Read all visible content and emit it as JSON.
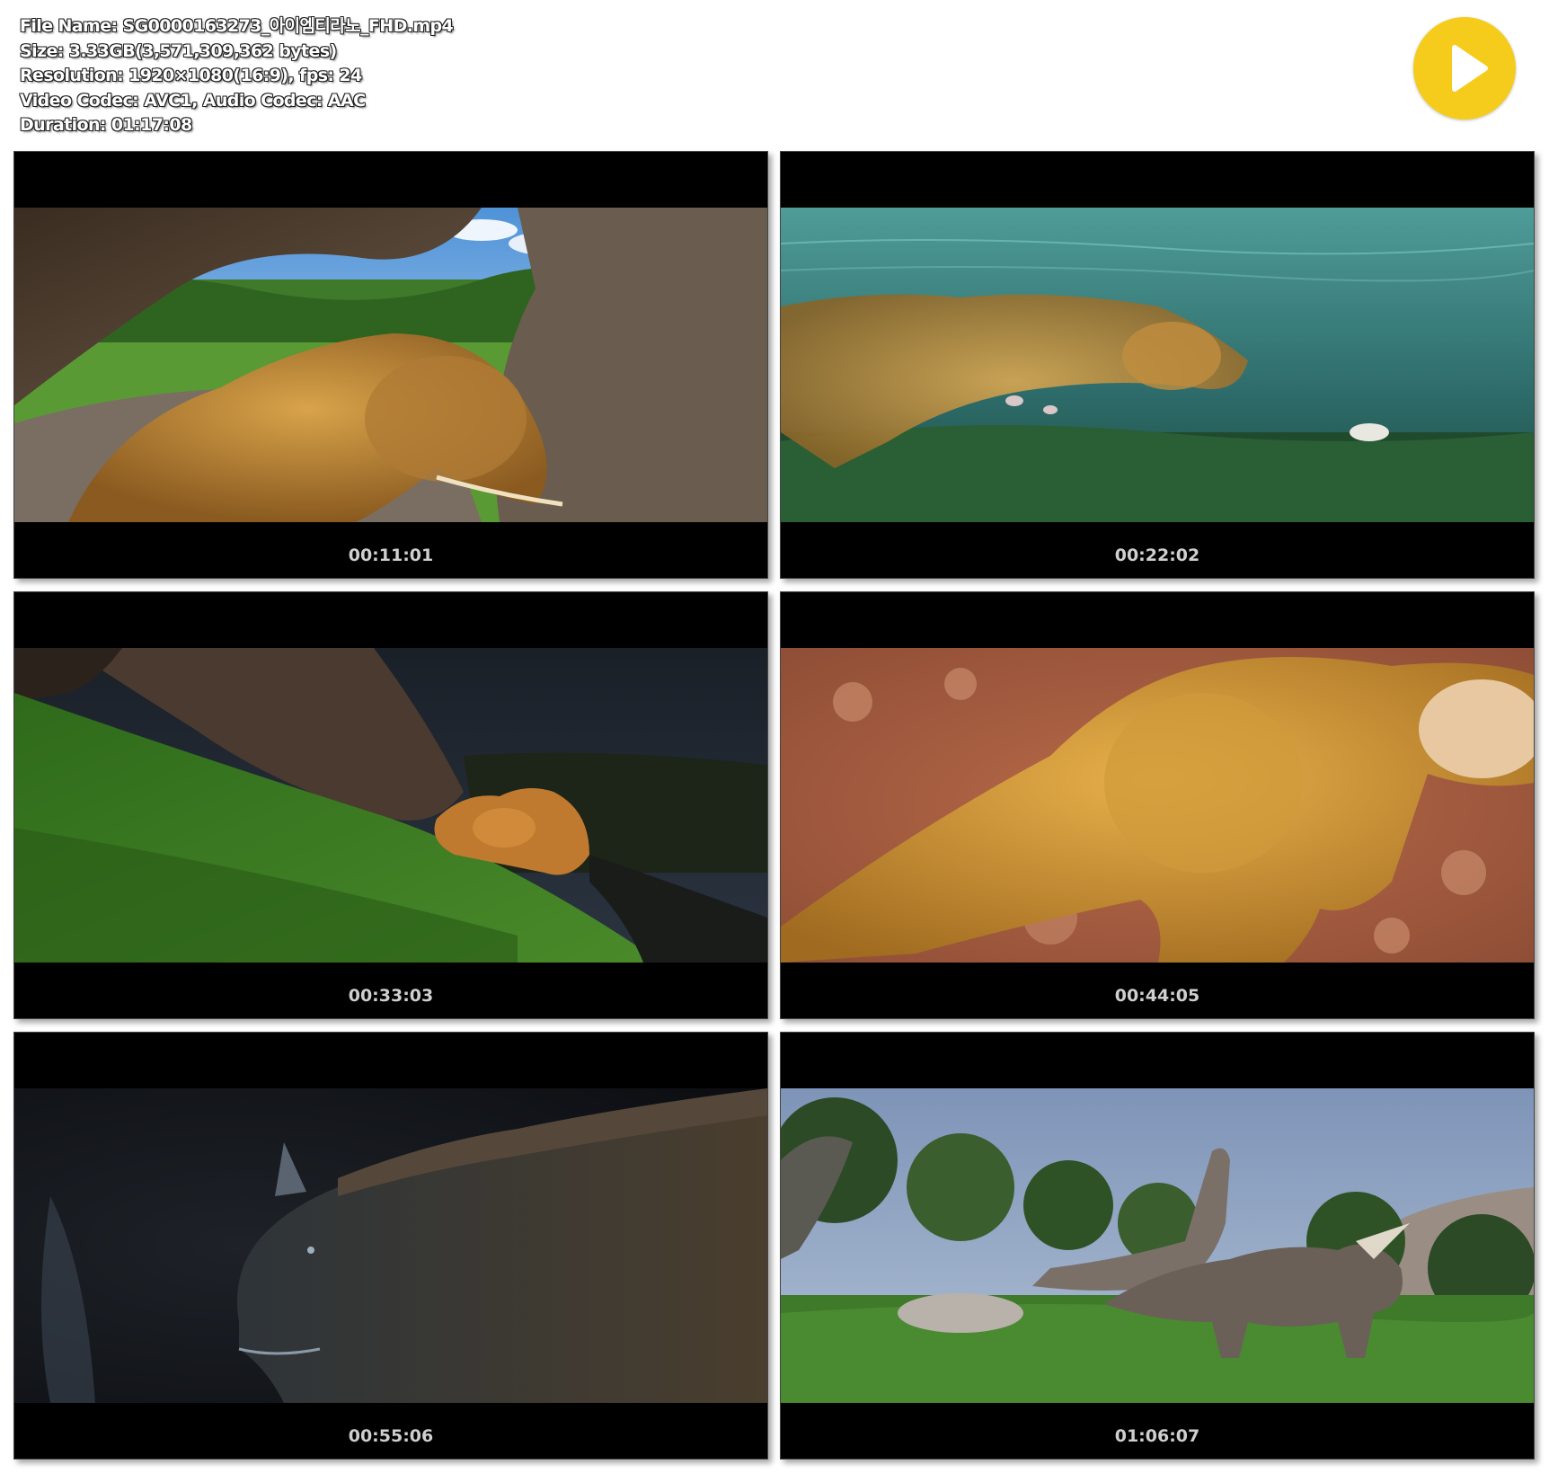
{
  "file_info": {
    "file_name": "File Name: SG0000163273_아이엠티라노_FHD.mp4",
    "size": "Size: 3.33GB(3,571,309,362 bytes)",
    "resolution": "Resolution: 1920×1080(16:9), fps: 24",
    "codecs": "Video Codec: AVC1, Audio Codec: AAC",
    "duration": "Duration: 01:17:08"
  },
  "play_icon": "play-icon",
  "colors": {
    "play_button": "#f5cc1c",
    "thumb_bg": "#000000",
    "timestamp": "#cfcfcf"
  },
  "thumbnails": [
    {
      "timestamp": "00:11:01",
      "scene": "trex-under-rock-arch"
    },
    {
      "timestamp": "00:22:02",
      "scene": "trex-underwater"
    },
    {
      "timestamp": "00:33:03",
      "scene": "dino-on-grassy-slope-night"
    },
    {
      "timestamp": "00:44:05",
      "scene": "trex-body-on-rocky-ground"
    },
    {
      "timestamp": "00:55:06",
      "scene": "horned-dino-dark-cave"
    },
    {
      "timestamp": "01:06:07",
      "scene": "triceratops-in-forest"
    }
  ]
}
